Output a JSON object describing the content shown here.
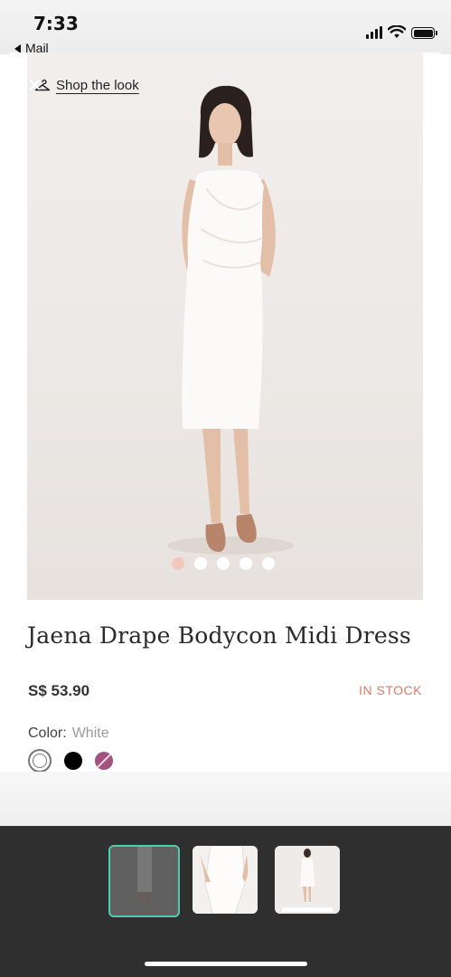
{
  "status_bar": {
    "time": "7:33",
    "back_label": "Mail"
  },
  "header": {
    "close_icon": "close-icon",
    "shop_the_look": "Shop the look"
  },
  "gallery": {
    "image_count": 5,
    "active_index": 0,
    "dot_active_color": "#f2c7bd"
  },
  "product": {
    "title": "Jaena Drape Bodycon Midi Dress",
    "price": "S$ 53.90",
    "stock_status": "IN STOCK",
    "stock_color": "#e07a6b",
    "color_label": "Color:",
    "color_value": "White",
    "swatches": [
      "white",
      "black",
      "purple"
    ]
  },
  "app_switcher": {
    "selected_index": 0,
    "accent_color": "#4ecdb0",
    "thumbnail_count": 3
  }
}
